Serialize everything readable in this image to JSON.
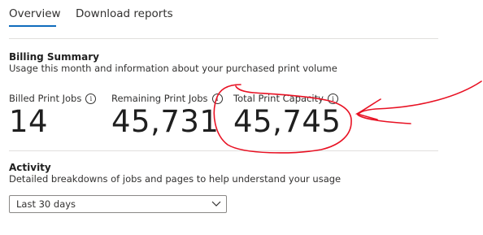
{
  "tabs": [
    {
      "label": "Overview",
      "active": true
    },
    {
      "label": "Download reports",
      "active": false
    }
  ],
  "billing_summary": {
    "title": "Billing Summary",
    "description": "Usage this month and information about your purchased print volume",
    "metrics": [
      {
        "label": "Billed Print Jobs",
        "value": "14"
      },
      {
        "label": "Remaining Print Jobs",
        "value": "45,731"
      },
      {
        "label": "Total Print Capacity",
        "value": "45,745"
      }
    ]
  },
  "activity": {
    "title": "Activity",
    "description": "Detailed breakdowns of jobs and pages to help understand your usage",
    "range_selected": "Last 30 days"
  },
  "colors": {
    "accent": "#0f6cbd",
    "annotation": "#e81123"
  },
  "icons": {
    "info": "info-circle-icon",
    "dropdown": "chevron-down-icon"
  }
}
